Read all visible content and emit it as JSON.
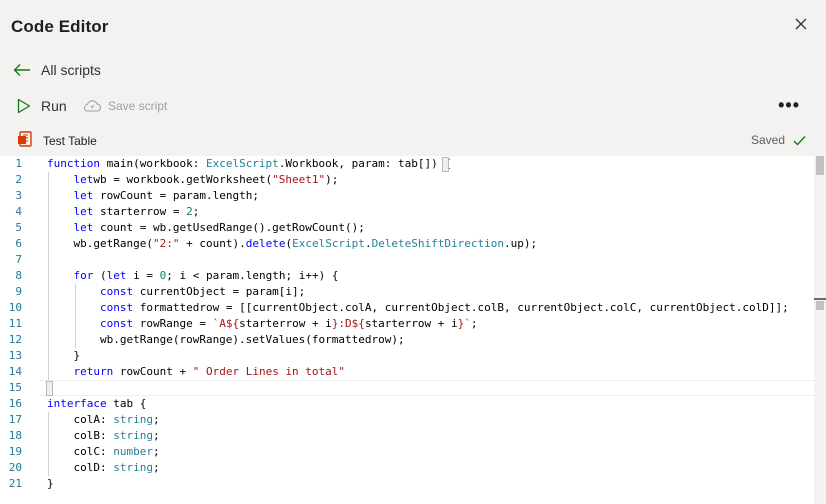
{
  "header": {
    "title": "Code Editor",
    "close_icon": "close-icon"
  },
  "nav": {
    "back_label": "All scripts",
    "back_icon": "arrow-left-icon"
  },
  "toolbar": {
    "run_label": "Run",
    "save_label": "Save script",
    "more_label": "•••"
  },
  "file": {
    "name": "Test Table",
    "status": "Saved"
  },
  "colors": {
    "accent": "#107c10",
    "file_icon": "#d83b01",
    "keyword": "#0000ff",
    "type": "#267f99",
    "string": "#a31515",
    "number": "#098658",
    "line_number": "#237893"
  },
  "editor": {
    "line_numbers": [
      "1",
      "2",
      "3",
      "4",
      "5",
      "6",
      "7",
      "8",
      "9",
      "10",
      "11",
      "12",
      "13",
      "14",
      "15",
      "16",
      "17",
      "18",
      "19",
      "20",
      "21"
    ],
    "lines": [
      [
        [
          "kw",
          "function"
        ],
        [
          "",
          "main(workbook: "
        ],
        [
          "type",
          "ExcelScript"
        ],
        [
          "",
          ".Workbook, param: tab[]) {"
        ]
      ],
      [
        [
          "",
          "    "
        ],
        [
          "kw",
          "let"
        ],
        [
          "",
          ""
        ],
        [
          "",
          "wb = workbook.getWorksheet("
        ],
        [
          "str",
          "\"Sheet1\""
        ],
        [
          "",
          ");"
        ]
      ],
      [
        [
          "",
          "    "
        ],
        [
          "kw",
          "let"
        ],
        [
          "",
          "rowCount = param.length;"
        ]
      ],
      [
        [
          "",
          "    "
        ],
        [
          "kw",
          "let"
        ],
        [
          "",
          "starterrow = "
        ],
        [
          "num",
          "2"
        ],
        [
          "",
          ";"
        ]
      ],
      [
        [
          "",
          "    "
        ],
        [
          "kw",
          "let"
        ],
        [
          "",
          "count = wb.getUsedRange().getRowCount();"
        ]
      ],
      [
        [
          "",
          "    wb.getRange("
        ],
        [
          "str",
          "\"2:\""
        ],
        [
          "",
          " + count)."
        ],
        [
          "kw",
          "delete"
        ],
        [
          "",
          "("
        ],
        [
          "type",
          "ExcelScript"
        ],
        [
          "",
          "."
        ],
        [
          "type",
          "DeleteShiftDirection"
        ],
        [
          "",
          ".up);"
        ]
      ],
      [
        [
          "",
          ""
        ]
      ],
      [
        [
          "",
          "    "
        ],
        [
          "kw",
          "for"
        ],
        [
          "",
          " ("
        ],
        [
          "kw",
          "let"
        ],
        [
          "",
          "i = "
        ],
        [
          "num",
          "0"
        ],
        [
          "",
          "; i < param.length; i++) {"
        ]
      ],
      [
        [
          "",
          "        "
        ],
        [
          "kw",
          "const"
        ],
        [
          "",
          "currentObject = param[i];"
        ]
      ],
      [
        [
          "",
          "        "
        ],
        [
          "kw",
          "const"
        ],
        [
          "",
          "formattedrow = [[currentObject.colA, currentObject.colB, currentObject.colC, currentObject.colD]];"
        ]
      ],
      [
        [
          "",
          "        "
        ],
        [
          "kw",
          "const"
        ],
        [
          "",
          "rowRange = "
        ],
        [
          "str",
          "`A${"
        ],
        [
          "",
          "starterrow + i"
        ],
        [
          "str",
          "}:D${"
        ],
        [
          "",
          "starterrow + i"
        ],
        [
          "str",
          "}`"
        ],
        [
          "",
          ";"
        ]
      ],
      [
        [
          "",
          "        wb.getRange(rowRange).setValues(formattedrow);"
        ]
      ],
      [
        [
          "",
          "    }"
        ]
      ],
      [
        [
          "",
          "    "
        ],
        [
          "kw",
          "return"
        ],
        [
          "",
          "rowCount + "
        ],
        [
          "str",
          "\" Order Lines in total\""
        ]
      ],
      [
        [
          "",
          "}"
        ]
      ],
      [
        [
          "kw",
          "interface"
        ],
        [
          "",
          "tab {"
        ]
      ],
      [
        [
          "",
          "    colA: "
        ],
        [
          "type",
          "string"
        ],
        [
          "",
          ";"
        ]
      ],
      [
        [
          "",
          "    colB: "
        ],
        [
          "type",
          "string"
        ],
        [
          "",
          ";"
        ]
      ],
      [
        [
          "",
          "    colC: "
        ],
        [
          "type",
          "number"
        ],
        [
          "",
          ";"
        ]
      ],
      [
        [
          "",
          "    colD: "
        ],
        [
          "type",
          "string"
        ],
        [
          "",
          ";"
        ]
      ],
      [
        [
          "",
          "}"
        ]
      ]
    ]
  }
}
